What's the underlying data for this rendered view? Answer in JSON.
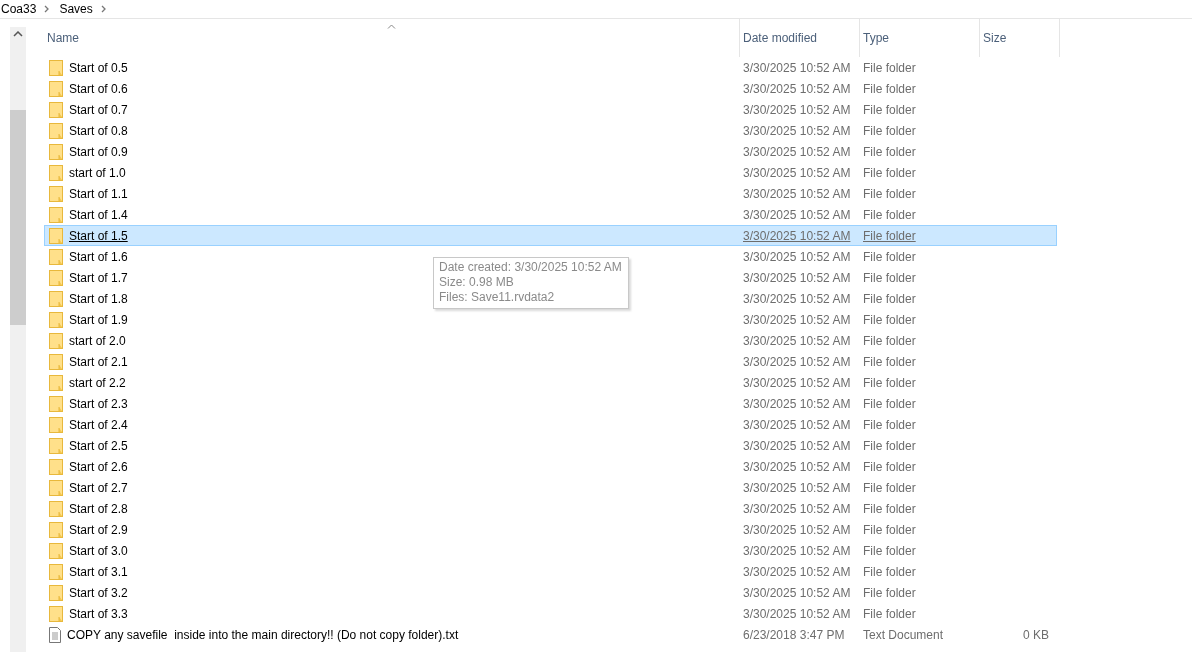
{
  "breadcrumb": [
    {
      "label": "Coa33"
    },
    {
      "label": "Saves"
    }
  ],
  "columns": [
    {
      "label": "Name"
    },
    {
      "label": "Date modified"
    },
    {
      "label": "Type"
    },
    {
      "label": "Size"
    }
  ],
  "rows": [
    {
      "kind": "folder",
      "name": "Start of 0.5",
      "date": "3/30/2025 10:52 AM",
      "type": "File folder",
      "selected": false
    },
    {
      "kind": "folder",
      "name": "Start of 0.6",
      "date": "3/30/2025 10:52 AM",
      "type": "File folder",
      "selected": false
    },
    {
      "kind": "folder",
      "name": "Start of 0.7",
      "date": "3/30/2025 10:52 AM",
      "type": "File folder",
      "selected": false
    },
    {
      "kind": "folder",
      "name": "Start of 0.8",
      "date": "3/30/2025 10:52 AM",
      "type": "File folder",
      "selected": false
    },
    {
      "kind": "folder",
      "name": "Start of 0.9",
      "date": "3/30/2025 10:52 AM",
      "type": "File folder",
      "selected": false
    },
    {
      "kind": "folder",
      "name": "start of 1.0",
      "date": "3/30/2025 10:52 AM",
      "type": "File folder",
      "selected": false
    },
    {
      "kind": "folder",
      "name": "Start of 1.1",
      "date": "3/30/2025 10:52 AM",
      "type": "File folder",
      "selected": false
    },
    {
      "kind": "folder",
      "name": "Start of 1.4",
      "date": "3/30/2025 10:52 AM",
      "type": "File folder",
      "selected": false
    },
    {
      "kind": "folder",
      "name": "Start of 1.5",
      "date": "3/30/2025 10:52 AM",
      "type": "File folder",
      "selected": true
    },
    {
      "kind": "folder",
      "name": "Start of 1.6",
      "date": "3/30/2025 10:52 AM",
      "type": "File folder",
      "selected": false
    },
    {
      "kind": "folder",
      "name": "Start of 1.7",
      "date": "3/30/2025 10:52 AM",
      "type": "File folder",
      "selected": false
    },
    {
      "kind": "folder",
      "name": "Start of 1.8",
      "date": "3/30/2025 10:52 AM",
      "type": "File folder",
      "selected": false
    },
    {
      "kind": "folder",
      "name": "Start of 1.9",
      "date": "3/30/2025 10:52 AM",
      "type": "File folder",
      "selected": false
    },
    {
      "kind": "folder",
      "name": "start of 2.0",
      "date": "3/30/2025 10:52 AM",
      "type": "File folder",
      "selected": false
    },
    {
      "kind": "folder",
      "name": "Start of 2.1",
      "date": "3/30/2025 10:52 AM",
      "type": "File folder",
      "selected": false
    },
    {
      "kind": "folder",
      "name": "start of 2.2",
      "date": "3/30/2025 10:52 AM",
      "type": "File folder",
      "selected": false
    },
    {
      "kind": "folder",
      "name": "Start of 2.3",
      "date": "3/30/2025 10:52 AM",
      "type": "File folder",
      "selected": false
    },
    {
      "kind": "folder",
      "name": "Start of 2.4",
      "date": "3/30/2025 10:52 AM",
      "type": "File folder",
      "selected": false
    },
    {
      "kind": "folder",
      "name": "Start of 2.5",
      "date": "3/30/2025 10:52 AM",
      "type": "File folder",
      "selected": false
    },
    {
      "kind": "folder",
      "name": "Start of 2.6",
      "date": "3/30/2025 10:52 AM",
      "type": "File folder",
      "selected": false
    },
    {
      "kind": "folder",
      "name": "Start of 2.7",
      "date": "3/30/2025 10:52 AM",
      "type": "File folder",
      "selected": false
    },
    {
      "kind": "folder",
      "name": "Start of 2.8",
      "date": "3/30/2025 10:52 AM",
      "type": "File folder",
      "selected": false
    },
    {
      "kind": "folder",
      "name": "Start of 2.9",
      "date": "3/30/2025 10:52 AM",
      "type": "File folder",
      "selected": false
    },
    {
      "kind": "folder",
      "name": "Start of 3.0",
      "date": "3/30/2025 10:52 AM",
      "type": "File folder",
      "selected": false
    },
    {
      "kind": "folder",
      "name": "Start of 3.1",
      "date": "3/30/2025 10:52 AM",
      "type": "File folder",
      "selected": false
    },
    {
      "kind": "folder",
      "name": "Start of 3.2",
      "date": "3/30/2025 10:52 AM",
      "type": "File folder",
      "selected": false
    },
    {
      "kind": "folder",
      "name": "Start of 3.3",
      "date": "3/30/2025 10:52 AM",
      "type": "File folder",
      "selected": false
    },
    {
      "kind": "text",
      "name": "COPY any savefile  inside into the main directory!! (Do not copy folder).txt",
      "date": "6/23/2018 3:47 PM",
      "type": "Text Document",
      "size": "0 KB",
      "selected": false
    }
  ],
  "tooltip": {
    "lines": [
      "Date created: 3/30/2025 10:52 AM",
      "Size: 0.98 MB",
      "Files: Save11.rvdata2"
    ]
  }
}
